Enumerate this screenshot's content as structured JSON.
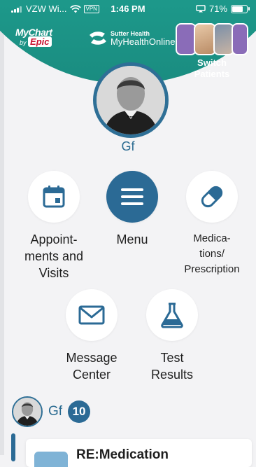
{
  "status_bar": {
    "carrier": "VZW Wi...",
    "vpn": "VPN",
    "time": "1:46 PM",
    "battery": "71%"
  },
  "header": {
    "mychart_logo": "MyChart",
    "epic_by": "by",
    "epic_logo": "Epic",
    "sutter_small": "Sutter Health",
    "sutter_brand": "MyHealthOnline",
    "switch_patients_label_line1": "Switch",
    "switch_patients_label_line2": "Patients"
  },
  "profile": {
    "name": "Gf"
  },
  "menu": [
    {
      "id": "appointments",
      "label_lines": [
        "Appoint-",
        "ments and",
        "Visits"
      ]
    },
    {
      "id": "menu",
      "label_lines": [
        "Menu"
      ]
    },
    {
      "id": "medications",
      "label_lines": [
        "Medica-",
        "tions/",
        "Prescription"
      ]
    },
    {
      "id": "messages",
      "label_lines": [
        "Message",
        "Center"
      ]
    },
    {
      "id": "test_results",
      "label_lines": [
        "Test",
        "Results"
      ]
    }
  ],
  "feed": {
    "patient_name": "Gf",
    "unread_count": "10",
    "card_title": "RE:Medication"
  },
  "colors": {
    "teal": "#1aa391",
    "navy": "#2b6a95",
    "background": "#f3f3f5"
  },
  "icons": {
    "appointments": "calendar-icon",
    "menu": "hamburger-menu-icon",
    "medications": "pill-capsule-icon",
    "messages": "envelope-icon",
    "test_results": "flask-icon"
  }
}
